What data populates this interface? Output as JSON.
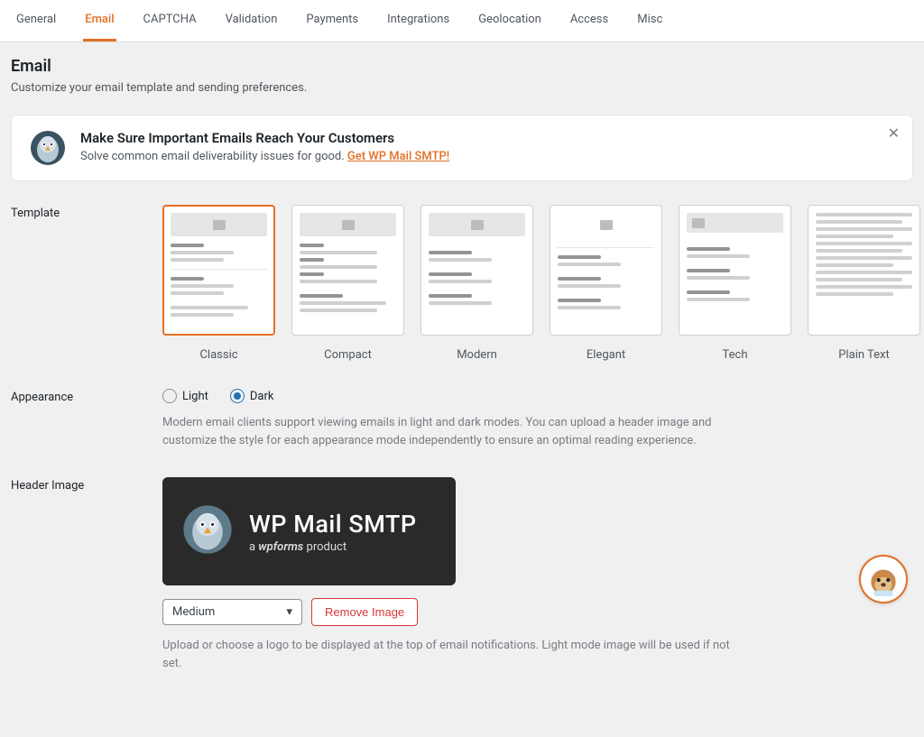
{
  "tabs": {
    "items": [
      {
        "label": "General"
      },
      {
        "label": "Email"
      },
      {
        "label": "CAPTCHA"
      },
      {
        "label": "Validation"
      },
      {
        "label": "Payments"
      },
      {
        "label": "Integrations"
      },
      {
        "label": "Geolocation"
      },
      {
        "label": "Access"
      },
      {
        "label": "Misc"
      }
    ],
    "active_index": 1
  },
  "page": {
    "title": "Email",
    "description": "Customize your email template and sending preferences."
  },
  "notice": {
    "title": "Make Sure Important Emails Reach Your Customers",
    "text": "Solve common email deliverability issues for good. ",
    "link_text": "Get WP Mail SMTP!"
  },
  "template": {
    "label": "Template",
    "options": [
      {
        "name": "Classic"
      },
      {
        "name": "Compact"
      },
      {
        "name": "Modern"
      },
      {
        "name": "Elegant"
      },
      {
        "name": "Tech"
      },
      {
        "name": "Plain Text"
      }
    ],
    "selected_index": 0
  },
  "appearance": {
    "label": "Appearance",
    "options": [
      {
        "label": "Light"
      },
      {
        "label": "Dark"
      }
    ],
    "selected_index": 1,
    "hint": "Modern email clients support viewing emails in light and dark modes. You can upload a header image and customize the style for each appearance mode independently to ensure an optimal reading experience."
  },
  "header_image": {
    "label": "Header Image",
    "preview_title": "WP Mail SMTP",
    "preview_sub_prefix": "a ",
    "preview_sub_brand": "wpforms",
    "preview_sub_suffix": " product",
    "size_selected": "Medium",
    "remove_label": "Remove Image",
    "hint": "Upload or choose a logo to be displayed at the top of email notifications. Light mode image will be used if not set."
  }
}
